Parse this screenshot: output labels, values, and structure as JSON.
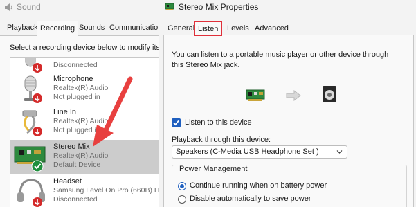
{
  "sound_window": {
    "title": "Sound",
    "tabs": [
      {
        "label": "Playback",
        "active": false
      },
      {
        "label": "Recording",
        "active": true
      },
      {
        "label": "Sounds",
        "active": false
      },
      {
        "label": "Communications",
        "active": false
      }
    ],
    "instruction": "Select a recording device below to modify its",
    "devices": [
      {
        "name": "",
        "driver": "",
        "status": "Disconnected",
        "icon": "microphone-icon",
        "badge": "disconnected"
      },
      {
        "name": "Microphone",
        "driver": "Realtek(R) Audio",
        "status": "Not plugged in",
        "icon": "microphone-icon",
        "badge": "disconnected"
      },
      {
        "name": "Line In",
        "driver": "Realtek(R) Audio",
        "status": "Not plugged in",
        "icon": "line-in-icon",
        "badge": "disconnected"
      },
      {
        "name": "Stereo Mix",
        "driver": "Realtek(R) Audio",
        "status": "Default Device",
        "icon": "sound-card-icon",
        "badge": "default",
        "selected": true
      },
      {
        "name": "Headset",
        "driver": "Samsung Level On Pro (660B) He",
        "status": "Disconnected",
        "icon": "headset-icon",
        "badge": "disconnected"
      }
    ]
  },
  "props_window": {
    "title": "Stereo Mix Properties",
    "tabs": [
      {
        "label": "General",
        "active": false
      },
      {
        "label": "Listen",
        "active": true
      },
      {
        "label": "Levels",
        "active": false
      },
      {
        "label": "Advanced",
        "active": false
      }
    ],
    "description": "You can listen to a portable music player or other device through this Stereo Mix jack.",
    "listen_checkbox": {
      "label": "Listen to this device",
      "checked": true
    },
    "playback_label": "Playback through this device:",
    "playback_value": "Speakers (C-Media USB Headphone Set  )",
    "power_management": {
      "title": "Power Management",
      "options": [
        {
          "label": "Continue running when on battery power",
          "checked": true
        },
        {
          "label": "Disable automatically to save power",
          "checked": false
        }
      ]
    }
  },
  "colors": {
    "accent": "#1f5fbf",
    "highlight_box": "#e0303a",
    "annotation_arrow": "#e8403f",
    "badge_red": "#d42a2a",
    "badge_green": "#1e8f3c",
    "selected_row": "#cccccc"
  }
}
